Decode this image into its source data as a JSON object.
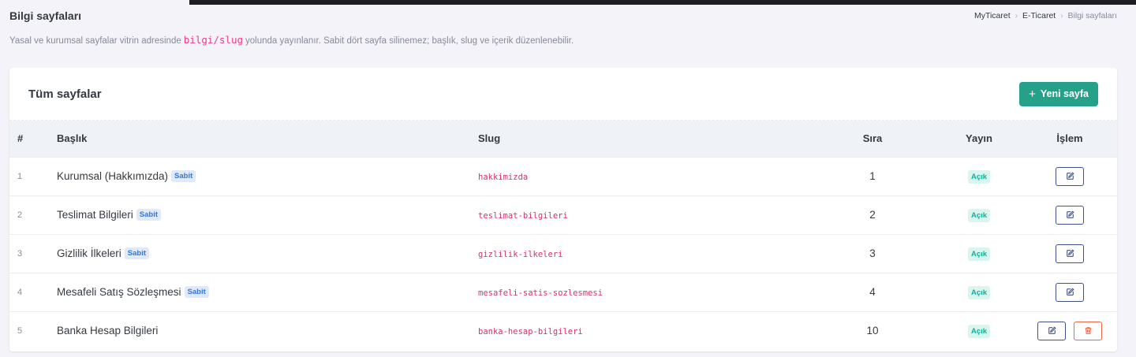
{
  "page": {
    "title": "Bilgi sayfaları",
    "subtitle_before": "Yasal ve kurumsal sayfalar vitrin adresinde",
    "subtitle_code": "bilgi/slug",
    "subtitle_after": "yolunda yayınlanır. Sabit dört sayfa silinemez; başlık, slug ve içerik düzenlenebilir."
  },
  "breadcrumb": [
    "MyTicaret",
    "E-Ticaret",
    "Bilgi sayfaları"
  ],
  "card": {
    "title": "Tüm sayfalar",
    "new_button_icon": "plus-icon",
    "new_button_label": "Yeni sayfa"
  },
  "table": {
    "headers": {
      "num": "#",
      "title": "Başlık",
      "slug": "Slug",
      "order": "Sıra",
      "published": "Yayın",
      "actions": "İşlem"
    },
    "rows": [
      {
        "num": "1",
        "title": "Kurumsal (Hakkımızda)",
        "badge": "Sabit",
        "slug": "hakkimizda",
        "order": "1",
        "status": "Açık",
        "deletable": false
      },
      {
        "num": "2",
        "title": "Teslimat Bilgileri",
        "badge": "Sabit",
        "slug": "teslimat-bilgileri",
        "order": "2",
        "status": "Açık",
        "deletable": false
      },
      {
        "num": "3",
        "title": "Gizlilik İlkeleri",
        "badge": "Sabit",
        "slug": "gizlilik-ilkeleri",
        "order": "3",
        "status": "Açık",
        "deletable": false
      },
      {
        "num": "4",
        "title": "Mesafeli Satış Sözleşmesi",
        "badge": "Sabit",
        "slug": "mesafeli-satis-sozlesmesi",
        "order": "4",
        "status": "Açık",
        "deletable": false
      },
      {
        "num": "5",
        "title": "Banka Hesap Bilgileri",
        "badge": "",
        "slug": "banka-hesap-bilgileri",
        "order": "10",
        "status": "Açık",
        "deletable": true
      }
    ]
  },
  "colors": {
    "primary_button": "#25a189",
    "edit_button": "#405189",
    "delete_button": "#f06548",
    "slug_text": "#d6336c",
    "badge_sabit_text": "#3577d4",
    "badge_acik_text": "#0ab39c"
  },
  "icons": {
    "edit": "edit-icon",
    "delete": "trash-icon"
  }
}
